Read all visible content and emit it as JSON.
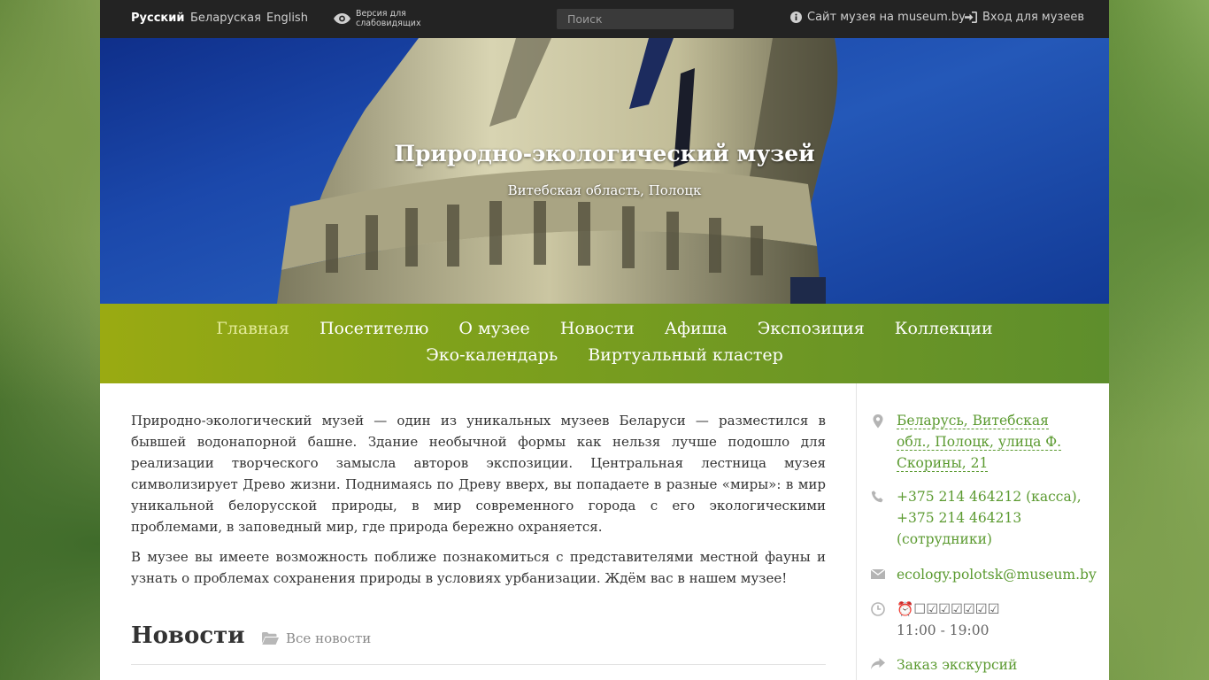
{
  "topbar": {
    "languages": [
      {
        "label": "Русский",
        "active": true
      },
      {
        "label": "Беларуская",
        "active": false
      },
      {
        "label": "English",
        "active": false
      }
    ],
    "low_vision_line1": "Версия для",
    "low_vision_line2": "слабовидящих",
    "search_placeholder": "Поиск",
    "museum_site_label": "Сайт музея на museum.by",
    "login_label": "Вход для музеев"
  },
  "hero": {
    "title": "Природно-экологический музей",
    "subtitle": "Витебская область, Полоцк"
  },
  "nav": {
    "items": [
      {
        "label": "Главная",
        "active": true
      },
      {
        "label": "Посетителю"
      },
      {
        "label": "О музее"
      },
      {
        "label": "Новости"
      },
      {
        "label": "Афиша"
      },
      {
        "label": "Экспозиция"
      },
      {
        "label": "Коллекции"
      },
      {
        "label": "Эко-календарь"
      },
      {
        "label": "Виртуальный кластер"
      }
    ]
  },
  "main": {
    "paragraph1": "Природно-экологический музей — один из уникальных музеев Беларуси — разместился в бывшей водонапорной башне. Здание необычной формы как нельзя лучше подошло для реализации творческого замысла авторов экспозиции. Центральная лестница музея символизирует Древо жизни. Поднимаясь по Древу вверх, вы попадаете в разные «миры»: в мир уникальной белорусской природы, в мир современного города с его экологическими проблемами, в заповедный мир, где природа бережно охраняется.",
    "paragraph2": "В музее вы имеете возможность поближе познакомиться с представителями местной фауны и узнать о проблемах сохранения природы в условиях урбанизации. Ждём вас в нашем музее!",
    "news_title": "Новости",
    "all_news_label": "Все новости"
  },
  "sidebar": {
    "address": "Беларусь, Витебская обл., Полоцк, улица Ф. Скорины, 21",
    "phones_line1": "+375 214 464212 (касса),",
    "phones_line2": "+375 214 464213",
    "phones_line3": "(сотрудники)",
    "email": "ecology.polotsk@museum.by",
    "hours_line1": "⏰☐☑☑☑☑☑☑",
    "hours_line2": "11:00 - 19:00",
    "excursion_label": "Заказ экскурсий"
  },
  "colors": {
    "topbar_bg": "#232323",
    "nav_gradient_start": "#9aaa12",
    "nav_gradient_end": "#5e8e2c",
    "link_green": "#5b9a30",
    "hero_sky": "#1b48ab"
  },
  "icons": [
    "eye-icon",
    "info-icon",
    "login-icon",
    "map-marker-icon",
    "phone-icon",
    "envelope-icon",
    "clock-icon",
    "share-arrow-icon",
    "folder-icon"
  ]
}
